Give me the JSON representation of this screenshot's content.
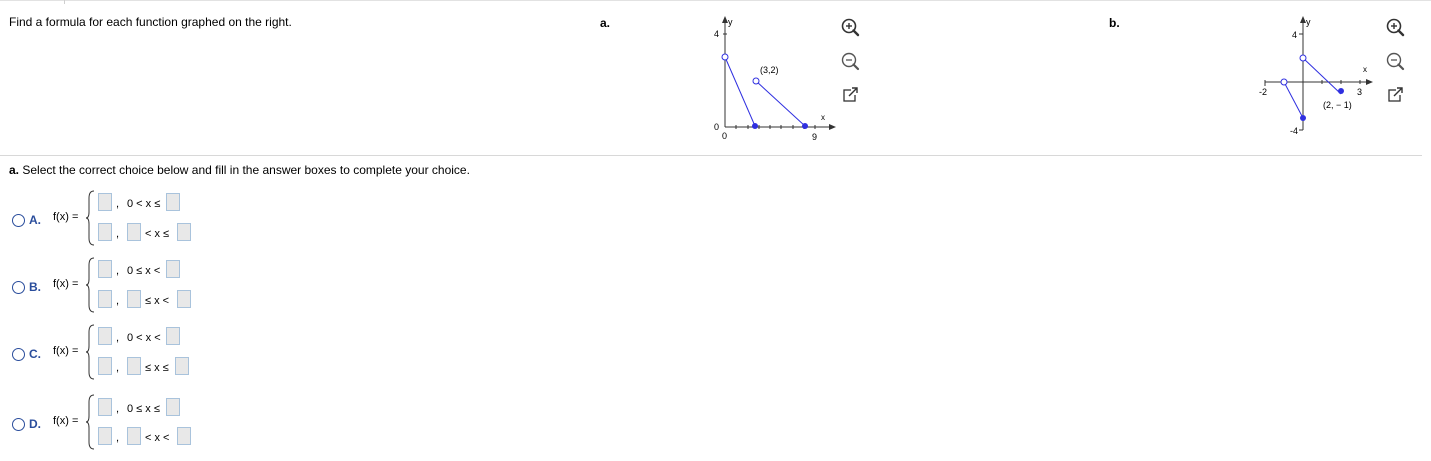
{
  "prompt": "Find a formula for each function graphed on the right.",
  "graph_a": {
    "label": "a.",
    "y_axis_label": "y",
    "x_axis_label": "x",
    "y_tick_label": "4",
    "x_origin_label": "0",
    "y_origin_label": "0",
    "x_tick_label": "9",
    "point_label": "(3,2)"
  },
  "graph_b": {
    "label": "b.",
    "y_axis_label": "y",
    "x_axis_label": "x",
    "y_top_label": "4",
    "y_bottom_label": "-4",
    "x_left_label": "-2",
    "x_right_label": "3",
    "point_label": "(2, − 1)"
  },
  "question": {
    "part": "a.",
    "text": "Select the correct choice below and fill in the answer boxes to complete your choice."
  },
  "choices": [
    {
      "letter": "A.",
      "fx": "f(x) =",
      "comma": ",",
      "cond1": "0 < x ≤",
      "cond2": "< x ≤"
    },
    {
      "letter": "B.",
      "fx": "f(x) =",
      "comma": ",",
      "cond1": "0 ≤ x <",
      "cond2": "≤ x <"
    },
    {
      "letter": "C.",
      "fx": "f(x) =",
      "comma": ",",
      "cond1": "0 < x <",
      "cond2": "≤ x ≤"
    },
    {
      "letter": "D.",
      "fx": "f(x) =",
      "comma": ",",
      "cond1": "0 ≤ x ≤",
      "cond2": "< x <"
    }
  ],
  "colors": {
    "accent": "#2a4d9c",
    "curve": "#2f2fe0",
    "axis": "#333333"
  },
  "icons": [
    "zoom-in-icon",
    "zoom-out-icon",
    "popout-icon"
  ]
}
